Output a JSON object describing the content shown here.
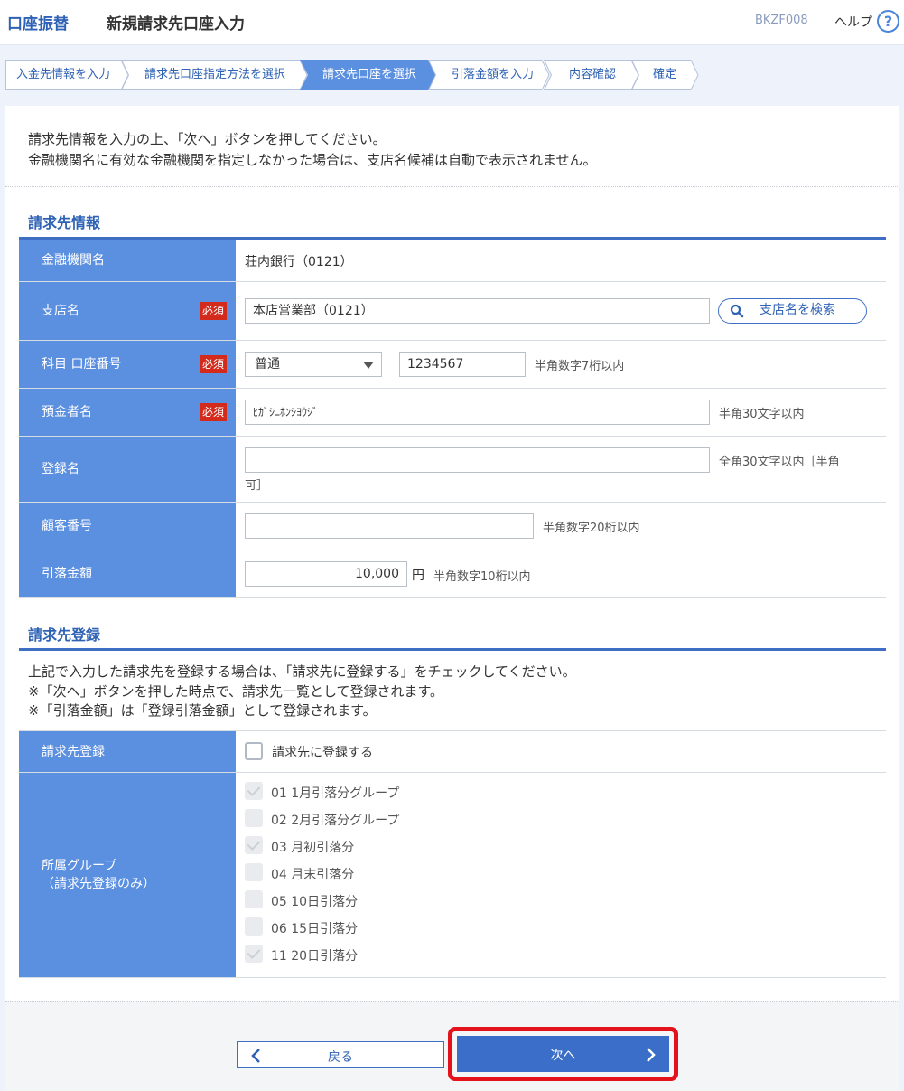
{
  "header": {
    "section": "口座振替",
    "title": "新規請求先口座入力",
    "screen_code": "BKZF008",
    "help": "ヘルプ",
    "help_icon": "?"
  },
  "steps": [
    {
      "label": "入金先情報を入力"
    },
    {
      "label": "請求先口座指定方法を選択"
    },
    {
      "label": "請求先口座を選択"
    },
    {
      "label": "引落金額を入力"
    },
    {
      "label": "内容確認"
    },
    {
      "label": "確定"
    }
  ],
  "intro": {
    "line1": "請求先情報を入力の上、「次へ」ボタンを押してください。",
    "line2": "金融機関名に有効な金融機関を指定しなかった場合は、支店名候補は自動で表示されません。"
  },
  "billing_info": {
    "heading": "請求先情報",
    "required_badge": "必須",
    "bank": {
      "label": "金融機関名",
      "value": "荘内銀行（0121）"
    },
    "branch": {
      "label": "支店名",
      "value": "本店営業部（0121）",
      "search_button": "支店名を検索"
    },
    "account": {
      "label": "科目 口座番号",
      "type": "普通",
      "number": "1234567",
      "note": "半角数字7桁以内"
    },
    "holder": {
      "label": "預金者名",
      "value": "ﾋｶﾞｼﾆﾎﾝｼﾖｳｼﾞ",
      "note": "半角30文字以内"
    },
    "reg_name": {
      "label": "登録名",
      "value": "",
      "note1": "全角30文字以内［半角",
      "note2": "可］"
    },
    "customer_no": {
      "label": "顧客番号",
      "value": "",
      "note": "半角数字20桁以内"
    },
    "amount": {
      "label": "引落金額",
      "value": "10,000",
      "unit": "円",
      "note": "半角数字10桁以内"
    }
  },
  "registration": {
    "heading": "請求先登録",
    "text1": "上記で入力した請求先を登録する場合は、「請求先に登録する」をチェックしてください。",
    "text2": "※「次へ」ボタンを押した時点で、請求先一覧として登録されます。",
    "text3": "※「引落金額」は「登録引落金額」として登録されます。",
    "reg_label": "請求先登録",
    "reg_checkbox": "請求先に登録する",
    "group_label1": "所属グループ",
    "group_label2": "（請求先登録のみ）",
    "groups": [
      {
        "label": "01 1月引落分グループ",
        "checked": true
      },
      {
        "label": "02 2月引落分グループ",
        "checked": false
      },
      {
        "label": "03 月初引落分",
        "checked": true
      },
      {
        "label": "04 月末引落分",
        "checked": false
      },
      {
        "label": "05 10日引落分",
        "checked": false
      },
      {
        "label": "06 15日引落分",
        "checked": false
      },
      {
        "label": "11 20日引落分",
        "checked": true
      }
    ]
  },
  "buttons": {
    "back": "戻る",
    "next": "次へ"
  }
}
